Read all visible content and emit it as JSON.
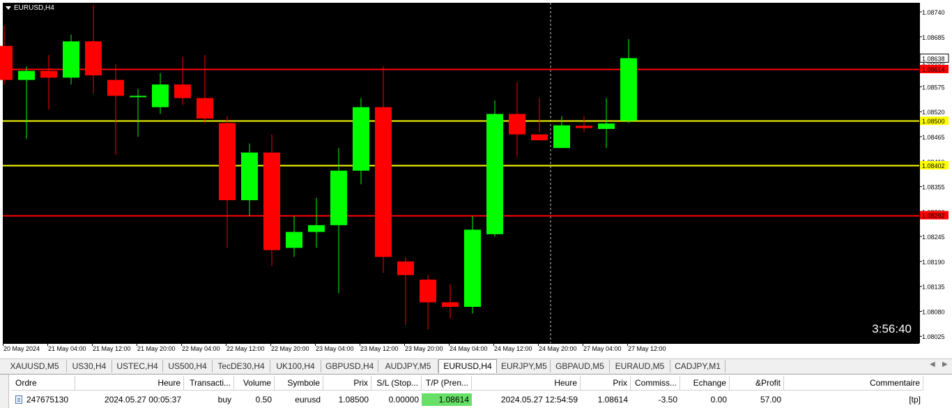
{
  "chart": {
    "symbol_label": "EURUSD,H4",
    "countdown": "3:56:40",
    "colors": {
      "background": "#000000",
      "bull": "#00ff00",
      "bear": "#ff0000",
      "axis_text": "#000000",
      "crosshair": "#c8c8c8"
    }
  },
  "chart_data": {
    "type": "candlestick",
    "title": "EURUSD,H4",
    "y_range": [
      1.0801,
      1.0876
    ],
    "y_ticks": [
      "1.08740",
      "1.08685",
      "1.08630",
      "1.08575",
      "1.08520",
      "1.08465",
      "1.08410",
      "1.08355",
      "1.08300",
      "1.08245",
      "1.08190",
      "1.08135",
      "1.08080",
      "1.08025"
    ],
    "x_ticks": [
      "20 May 2024",
      "21 May 04:00",
      "21 May 12:00",
      "21 May 20:00",
      "22 May 04:00",
      "22 May 12:00",
      "22 May 20:00",
      "23 May 04:00",
      "23 May 12:00",
      "23 May 20:00",
      "24 May 04:00",
      "24 May 12:00",
      "24 May 20:00",
      "27 May 04:00",
      "27 May 12:00"
    ],
    "candles": [
      {
        "o": 1.08665,
        "h": 1.0871,
        "l": 1.0858,
        "c": 1.0859
      },
      {
        "o": 1.0859,
        "h": 1.0862,
        "l": 1.0846,
        "c": 1.0861
      },
      {
        "o": 1.0861,
        "h": 1.08645,
        "l": 1.08525,
        "c": 1.08595
      },
      {
        "o": 1.08595,
        "h": 1.0869,
        "l": 1.0858,
        "c": 1.08675
      },
      {
        "o": 1.08675,
        "h": 1.08755,
        "l": 1.0856,
        "c": 1.086
      },
      {
        "o": 1.0859,
        "h": 1.08625,
        "l": 1.08425,
        "c": 1.08555
      },
      {
        "o": 1.08555,
        "h": 1.0857,
        "l": 1.08465,
        "c": 1.08555
      },
      {
        "o": 1.0853,
        "h": 1.08605,
        "l": 1.08515,
        "c": 1.0858
      },
      {
        "o": 1.0858,
        "h": 1.0864,
        "l": 1.08535,
        "c": 1.0855
      },
      {
        "o": 1.0855,
        "h": 1.08645,
        "l": 1.08495,
        "c": 1.08505
      },
      {
        "o": 1.08495,
        "h": 1.0851,
        "l": 1.0822,
        "c": 1.08325
      },
      {
        "o": 1.08325,
        "h": 1.0845,
        "l": 1.0829,
        "c": 1.0843
      },
      {
        "o": 1.0843,
        "h": 1.0847,
        "l": 1.0818,
        "c": 1.08215
      },
      {
        "o": 1.0822,
        "h": 1.0829,
        "l": 1.082,
        "c": 1.08255
      },
      {
        "o": 1.08255,
        "h": 1.0833,
        "l": 1.0822,
        "c": 1.0827
      },
      {
        "o": 1.0827,
        "h": 1.0844,
        "l": 1.0812,
        "c": 1.0839
      },
      {
        "o": 1.0839,
        "h": 1.0855,
        "l": 1.0836,
        "c": 1.0853
      },
      {
        "o": 1.0853,
        "h": 1.0862,
        "l": 1.08165,
        "c": 1.082
      },
      {
        "o": 1.0819,
        "h": 1.082,
        "l": 1.0805,
        "c": 1.0816
      },
      {
        "o": 1.0815,
        "h": 1.0816,
        "l": 1.0804,
        "c": 1.081
      },
      {
        "o": 1.081,
        "h": 1.0814,
        "l": 1.08065,
        "c": 1.0809
      },
      {
        "o": 1.0809,
        "h": 1.0829,
        "l": 1.08075,
        "c": 1.0826
      },
      {
        "o": 1.0825,
        "h": 1.08545,
        "l": 1.08245,
        "c": 1.08515
      },
      {
        "o": 1.08515,
        "h": 1.08585,
        "l": 1.0842,
        "c": 1.0847
      },
      {
        "o": 1.0847,
        "h": 1.0855,
        "l": 1.08475,
        "c": 1.08457
      },
      {
        "o": 1.0844,
        "h": 1.0851,
        "l": 1.0844,
        "c": 1.0849
      },
      {
        "o": 1.08489,
        "h": 1.0851,
        "l": 1.08475,
        "c": 1.08484
      },
      {
        "o": 1.08482,
        "h": 1.0855,
        "l": 1.0844,
        "c": 1.08494
      },
      {
        "o": 1.085,
        "h": 1.0868,
        "l": 1.08495,
        "c": 1.08638
      }
    ],
    "horizontal_lines": [
      {
        "price": 1.08614,
        "label": "1.08614",
        "color": "#ff0000"
      },
      {
        "price": 1.085,
        "label": "1.08500",
        "color": "#ffff00"
      },
      {
        "price": 1.08402,
        "label": "1.08402",
        "color": "#ffff00"
      },
      {
        "price": 1.08292,
        "label": "1.08292",
        "color": "#ff0000"
      }
    ],
    "current_price": {
      "price": 1.08638,
      "label": "1.08638"
    },
    "crosshair_candle_index": 24.5
  },
  "tabs": [
    {
      "label": "XAUUSD,M5"
    },
    {
      "label": "US30,H4"
    },
    {
      "label": "USTEC,H4"
    },
    {
      "label": "US500,H4"
    },
    {
      "label": "TecDE30,H4"
    },
    {
      "label": "UK100,H4"
    },
    {
      "label": "GBPUSD,H4"
    },
    {
      "label": "AUDJPY,M5"
    },
    {
      "label": "EURUSD,H4",
      "active": true
    },
    {
      "label": "EURJPY,M5"
    },
    {
      "label": "GBPAUD,M5"
    },
    {
      "label": "EURAUD,M5"
    },
    {
      "label": "CADJPY,M1"
    }
  ],
  "terminal": {
    "side_label": "inal",
    "headers": [
      "Ordre",
      "Heure",
      "Transacti...",
      "Volume",
      "Symbole",
      "Prix",
      "S/L (Stop...",
      "T/P (Pren...",
      "Heure",
      "Prix",
      "Commiss...",
      "Echange",
      "&Profit",
      "Commentaire"
    ],
    "rows": [
      [
        "247675130",
        "2024.05.27 00:05:37",
        "buy",
        "0.50",
        "eurusd",
        "1.08500",
        "0.00000",
        "1.08614",
        "2024.05.27 12:54:59",
        "1.08614",
        "-3.50",
        "0.00",
        "57.00",
        "[tp]"
      ]
    ]
  }
}
